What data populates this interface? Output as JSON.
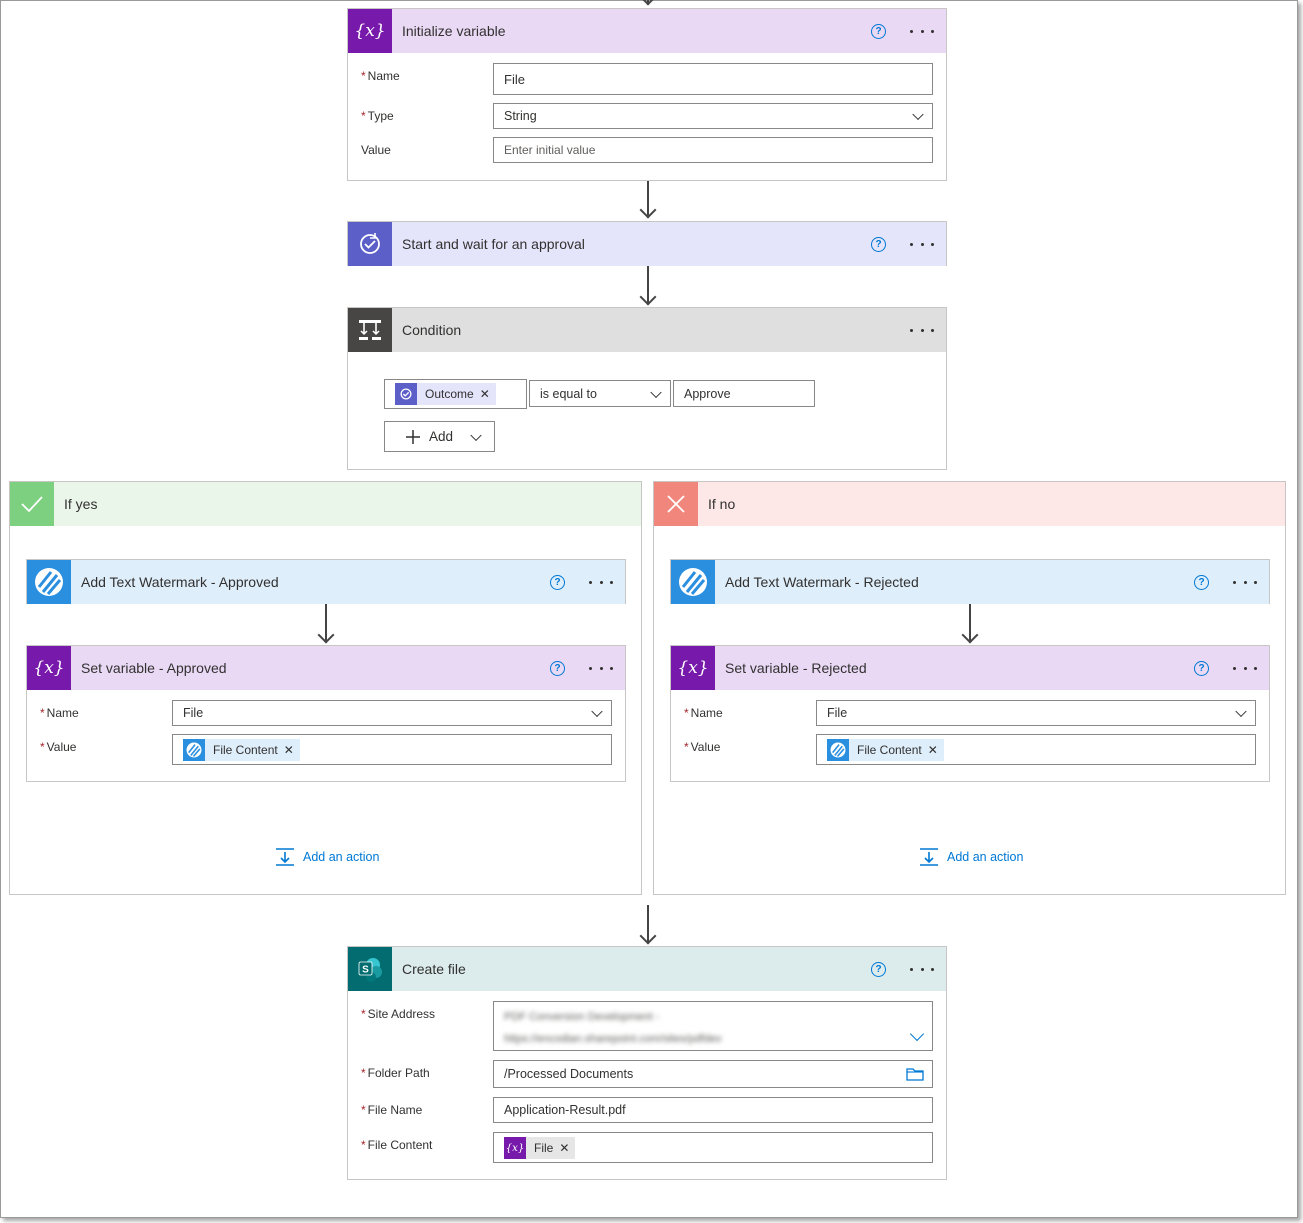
{
  "init_variable": {
    "title": "Initialize variable",
    "name_label": "Name",
    "name_value": "File",
    "type_label": "Type",
    "type_value": "String",
    "value_label": "Value",
    "value_placeholder": "Enter initial value",
    "color": "#7719aa",
    "header_bg": "#e9d9f5"
  },
  "approval": {
    "title": "Start and wait for an approval",
    "color": "#5b5fc7",
    "header_bg": "#e4e4fb"
  },
  "condition": {
    "title": "Condition",
    "token": "Outcome",
    "operator": "is equal to",
    "operand": "Approve",
    "add_label": "Add",
    "color": "#484644",
    "header_bg": "#dfdfdf"
  },
  "if_yes": {
    "label": "If yes",
    "color": "#7ed081",
    "header_bg": "#eaf6ea",
    "watermark_title": "Add Text Watermark - Approved",
    "set_title": "Set variable - Approved",
    "name_label": "Name",
    "name_value": "File",
    "value_label": "Value",
    "value_token": "File Content",
    "add_action": "Add an action"
  },
  "if_no": {
    "label": "If no",
    "color": "#f1867d",
    "header_bg": "#fde8e7",
    "watermark_title": "Add Text Watermark - Rejected",
    "set_title": "Set variable - Rejected",
    "name_label": "Name",
    "name_value": "File",
    "value_label": "Value",
    "value_token": "File Content",
    "add_action": "Add an action"
  },
  "create_file": {
    "title": "Create file",
    "site_label": "Site Address",
    "site_value": "PDF Conversion Development - https://encodian.sharepoint.com/sites/pdfdev",
    "folder_label": "Folder Path",
    "folder_value": "/Processed Documents",
    "filename_label": "File Name",
    "filename_value": "Application-Result.pdf",
    "content_label": "File Content",
    "content_token": "File",
    "color": "#036c70",
    "header_bg": "#dcebec"
  },
  "watermark_color": "#2b8fe0",
  "watermark_bg": "#deeefb"
}
